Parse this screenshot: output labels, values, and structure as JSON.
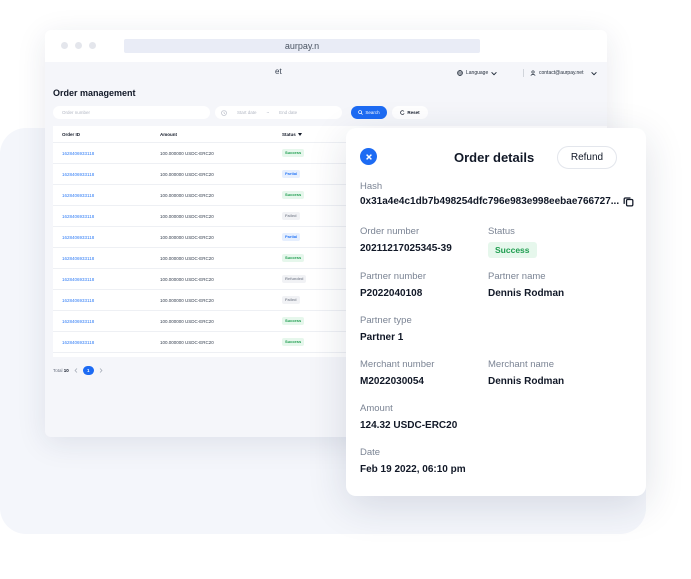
{
  "browser": {
    "url": "aurpay.n"
  },
  "app_bar": {
    "title_fragment": "et",
    "language_label": "Language",
    "account_email": "contact@aurpay.net"
  },
  "page": {
    "title": "Order management"
  },
  "filters": {
    "order_placeholder": "Order number",
    "start_date_placeholder": "Start date",
    "end_date_placeholder": "End date",
    "range_separator": "~",
    "search_label": "Search",
    "reset_label": "Reset"
  },
  "table": {
    "headers": {
      "order_id": "Order ID",
      "amount": "Amount",
      "status": "Status"
    },
    "rows": [
      {
        "order_id": "1628406933118",
        "amount": "100.000000  USDC-ERC20",
        "status": "Success"
      },
      {
        "order_id": "1628406933118",
        "amount": "100.000000  USDC-ERC20",
        "status": "Partial"
      },
      {
        "order_id": "1628406933118",
        "amount": "100.000000  USDC-ERC20",
        "status": "Success"
      },
      {
        "order_id": "1628406933118",
        "amount": "100.000000  USDC-ERC20",
        "status": "Failed"
      },
      {
        "order_id": "1628406933118",
        "amount": "100.000000  USDC-ERC20",
        "status": "Partial"
      },
      {
        "order_id": "1628406933118",
        "amount": "100.000000  USDC-ERC20",
        "status": "Success"
      },
      {
        "order_id": "1628406933118",
        "amount": "100.000000  USDC-ERC20",
        "status": "Refunded"
      },
      {
        "order_id": "1628406933118",
        "amount": "100.000000  USDC-ERC20",
        "status": "Failed"
      },
      {
        "order_id": "1628406933118",
        "amount": "100.000000  USDC-ERC20",
        "status": "Success"
      },
      {
        "order_id": "1628406933118",
        "amount": "100.000000  USDC-ERC20",
        "status": "Success"
      }
    ]
  },
  "pagination": {
    "total_label": "Total",
    "total": "10",
    "current_page": "1"
  },
  "status_colors": {
    "Success": {
      "bg": "#e6f7ec",
      "fg": "#1e9d4f"
    },
    "Partial": {
      "bg": "#e6effe",
      "fg": "#2f7cf6"
    },
    "Failed": {
      "bg": "#f1f2f5",
      "fg": "#8a909c"
    },
    "Refunded": {
      "bg": "#f1f2f5",
      "fg": "#8a909c"
    }
  },
  "details": {
    "title": "Order details",
    "refund_label": "Refund",
    "hash_label": "Hash",
    "hash_value": "0x31a4e4c1db7b498254dfc796e983e998eebae766727...",
    "order_number_label": "Order number",
    "order_number": "20211217025345-39",
    "status_label": "Status",
    "status": "Success",
    "partner_number_label": "Partner number",
    "partner_number": "P2022040108",
    "partner_name_label": "Partner name",
    "partner_name": "Dennis Rodman",
    "partner_type_label": "Partner type",
    "partner_type": "Partner 1",
    "merchant_number_label": "Merchant number",
    "merchant_number": "M2022030054",
    "merchant_name_label": "Merchant name",
    "merchant_name": "Dennis Rodman",
    "amount_label": "Amount",
    "amount": "124.32 USDC-ERC20",
    "date_label": "Date",
    "date": "Feb 19 2022, 06:10 pm"
  },
  "colors": {
    "accent": "#1d6bf3",
    "link": "#2f7cf6",
    "background": "#f4f6fb"
  },
  "icons": [
    "globe-icon",
    "user-icon",
    "chevron-down-icon",
    "calendar-icon",
    "search-icon",
    "reset-icon",
    "close-icon",
    "copy-icon",
    "chevron-left-icon",
    "chevron-right-icon",
    "sort-down-icon"
  ]
}
